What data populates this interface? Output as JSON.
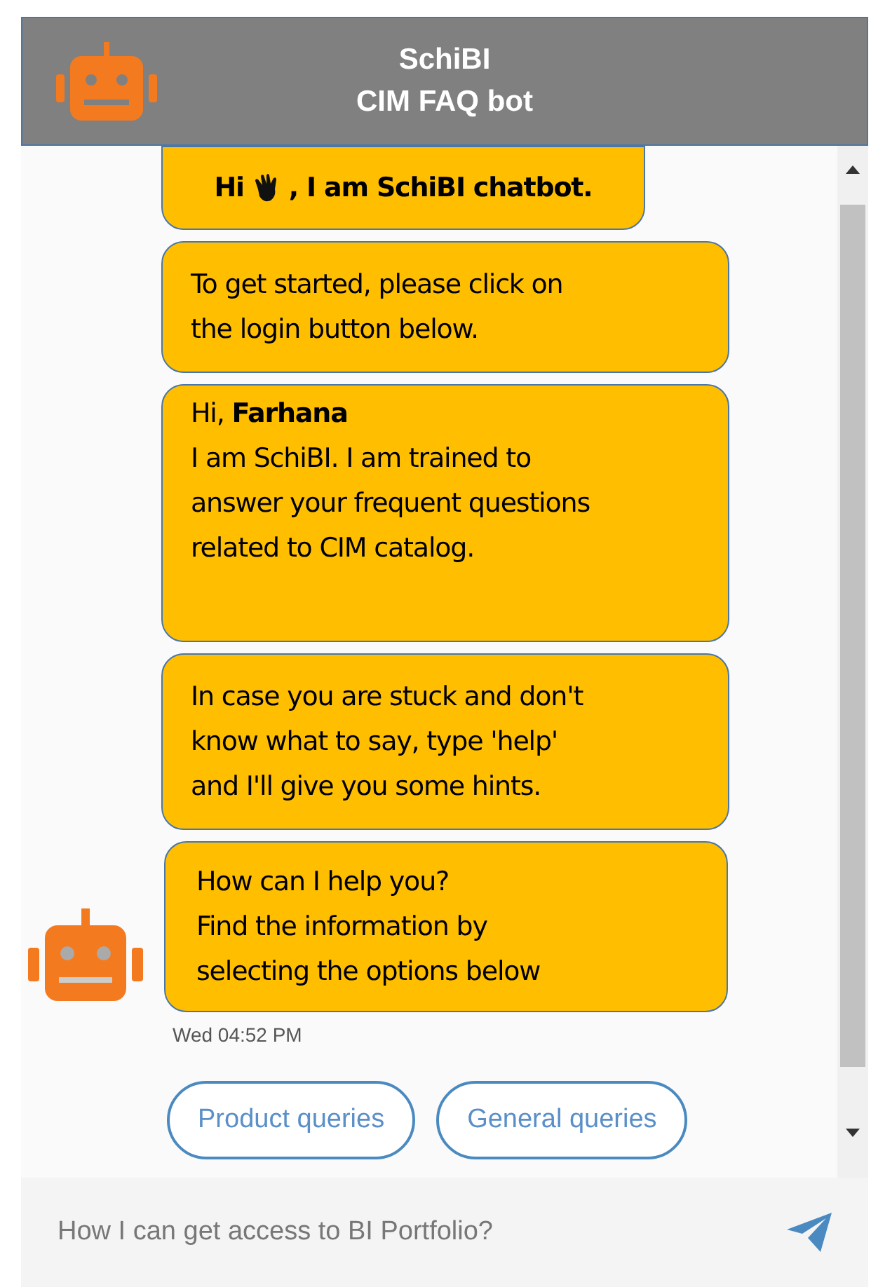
{
  "header": {
    "title": "SchiBI",
    "subtitle": "CIM FAQ bot"
  },
  "messages": [
    {
      "kind": "greeting",
      "before": "Hi",
      "after": ", I am SchiBI chatbot."
    },
    {
      "kind": "text",
      "text": "To get started, please click on\nthe login button below."
    },
    {
      "kind": "text",
      "text": "Hi, **Farhana**\nI am SchiBI. I am trained to\nanswer your frequent questions\nrelated to CIM catalog."
    },
    {
      "kind": "text",
      "text": "In case you are stuck and don't\nknow what to say, type 'help'\nand I'll give you some hints."
    },
    {
      "kind": "last",
      "text": "How can I help you?\nFind the information by\nselecting the options below",
      "time": "Wed 04:52 PM"
    }
  ],
  "quick_replies": [
    "Product queries",
    "General queries"
  ],
  "composer": {
    "placeholder": "How I can get access to BI Portfolio?"
  }
}
